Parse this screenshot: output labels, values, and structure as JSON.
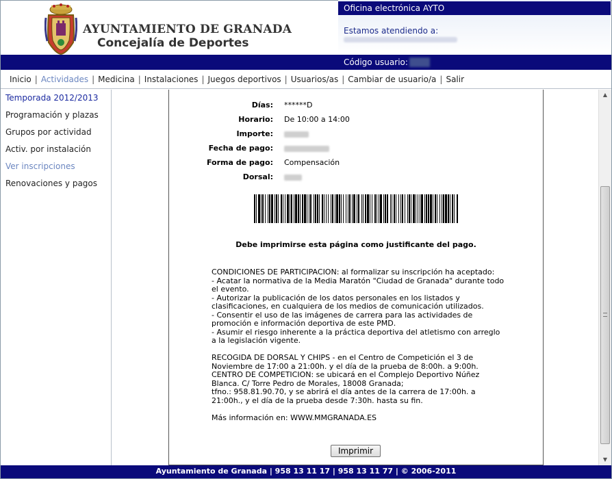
{
  "header": {
    "title_line1": "AYUNTAMIENTO DE GRANADA",
    "title_line2": "Concejalía de Deportes",
    "office_label": "Oficina electrónica AYTO",
    "attending_label": "Estamos atendiendo a:",
    "user_code_label": "Código usuario:"
  },
  "nav": {
    "items": [
      {
        "label": "Inicio"
      },
      {
        "label": "Actividades",
        "active": true
      },
      {
        "label": "Medicina"
      },
      {
        "label": "Instalaciones"
      },
      {
        "label": "Juegos deportivos"
      },
      {
        "label": "Usuarios/as"
      },
      {
        "label": "Cambiar de usuario/a"
      },
      {
        "label": "Salir"
      }
    ]
  },
  "sidebar": {
    "items": [
      {
        "label": "Temporada 2012/2013"
      },
      {
        "label": "Programación y plazas"
      },
      {
        "label": "Grupos por actividad"
      },
      {
        "label": "Activ. por instalación"
      },
      {
        "label": "Ver inscripciones"
      },
      {
        "label": "Renovaciones y pagos"
      }
    ]
  },
  "receipt": {
    "fields": [
      {
        "label": "Días:",
        "value": "******D"
      },
      {
        "label": "Horario:",
        "value": "De 10:00 a 14:00"
      },
      {
        "label": "Importe:",
        "value": ""
      },
      {
        "label": "Fecha de pago:",
        "value": ""
      },
      {
        "label": "Forma de pago:",
        "value": "Compensación"
      },
      {
        "label": "Dorsal:",
        "value": ""
      }
    ],
    "justify_text": "Debe imprimirse esta página como justificante del pago.",
    "conditions_text": "CONDICIONES DE PARTICIPACION: al formalizar su inscripción ha aceptado:\n- Acatar la normativa de la Media Maratón \"Ciudad de Granada\" durante todo el evento.\n- Autorizar la publicación de los datos personales en los listados y clasificaciones, en cualquiera de los medios de comunicación utilizados.\n- Consentir el uso de las imágenes de carrera para las actividades de promoción e información deportiva de este PMD.\n- Asumir el riesgo inherente a la práctica deportiva del atletismo con arreglo a la legislación vigente.\n\nRECOGIDA DE DORSAL Y CHIPS - en el Centro de Competición el 3 de Noviembre de 17:00 a 21:00h. y el día de la prueba de 8:00h. a 9:00h.\nCENTRO DE COMPETICION: se ubicará en el Complejo Deportivo Núñez Blanca. C/ Torre Pedro de Morales, 18008 Granada;\ntfno.: 958.81.90.70, y se abrirá el día antes de la carrera de 17:00h. a 21:00h., y el día de la prueba desde 7:30h. hasta su fin.\n\nMás información en: WWW.MMGRANADA.ES",
    "print_button": "Imprimir"
  },
  "footer": {
    "text": "Ayuntamiento de Granada | 958 13 11 17 | 958 13 11 77 | © 2006-2011"
  },
  "colors": {
    "header_bar": "#0a0a7a",
    "nav_active": "#6b86c0",
    "sidebar_active": "#1b2aa0"
  }
}
